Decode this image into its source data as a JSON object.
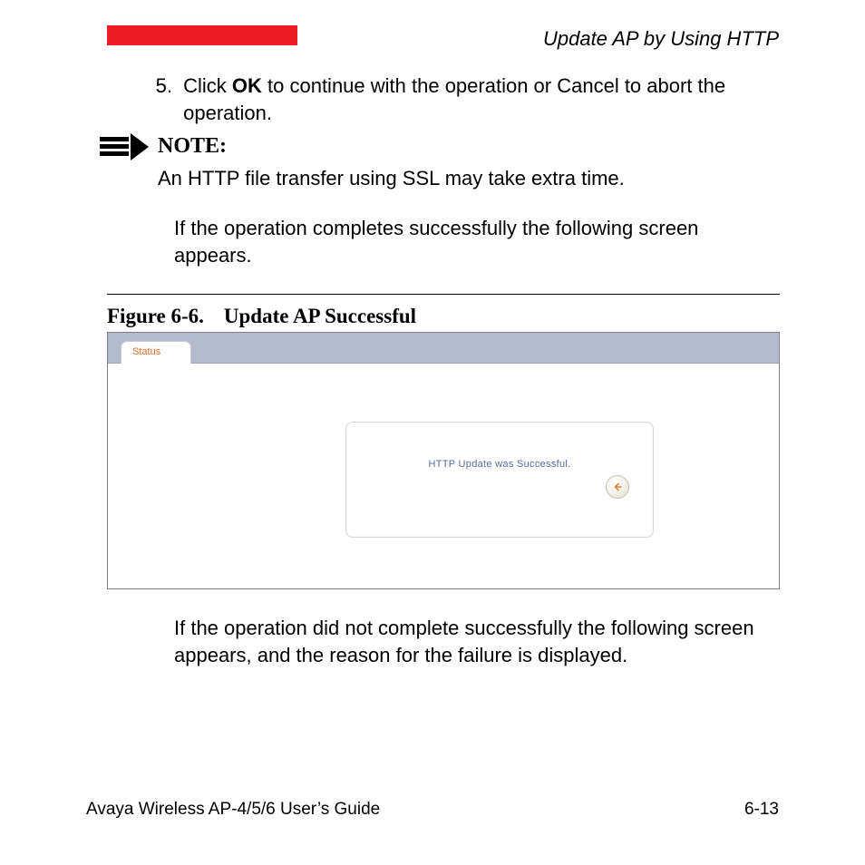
{
  "header": {
    "section_title": "Update AP by Using HTTP"
  },
  "step": {
    "number": "5.",
    "pre": "Click ",
    "bold": "OK",
    "post": " to continue with the operation or Cancel to abort the operation."
  },
  "note": {
    "label": "NOTE:",
    "body": "An HTTP file transfer using SSL may take extra time."
  },
  "success_intro": "If the operation completes successfully the following screen appears.",
  "figure": {
    "number": "Figure 6-6.",
    "title": "Update AP Successful",
    "tab_label": "Status",
    "message": "HTTP Update was Successful.",
    "back_icon": "back-arrow-icon"
  },
  "failure_para": "If the operation did not complete successfully the following screen appears, and the reason for the failure is displayed.",
  "footer": {
    "left": "Avaya Wireless AP-4/5/6 User’s Guide",
    "right": "6-13"
  }
}
